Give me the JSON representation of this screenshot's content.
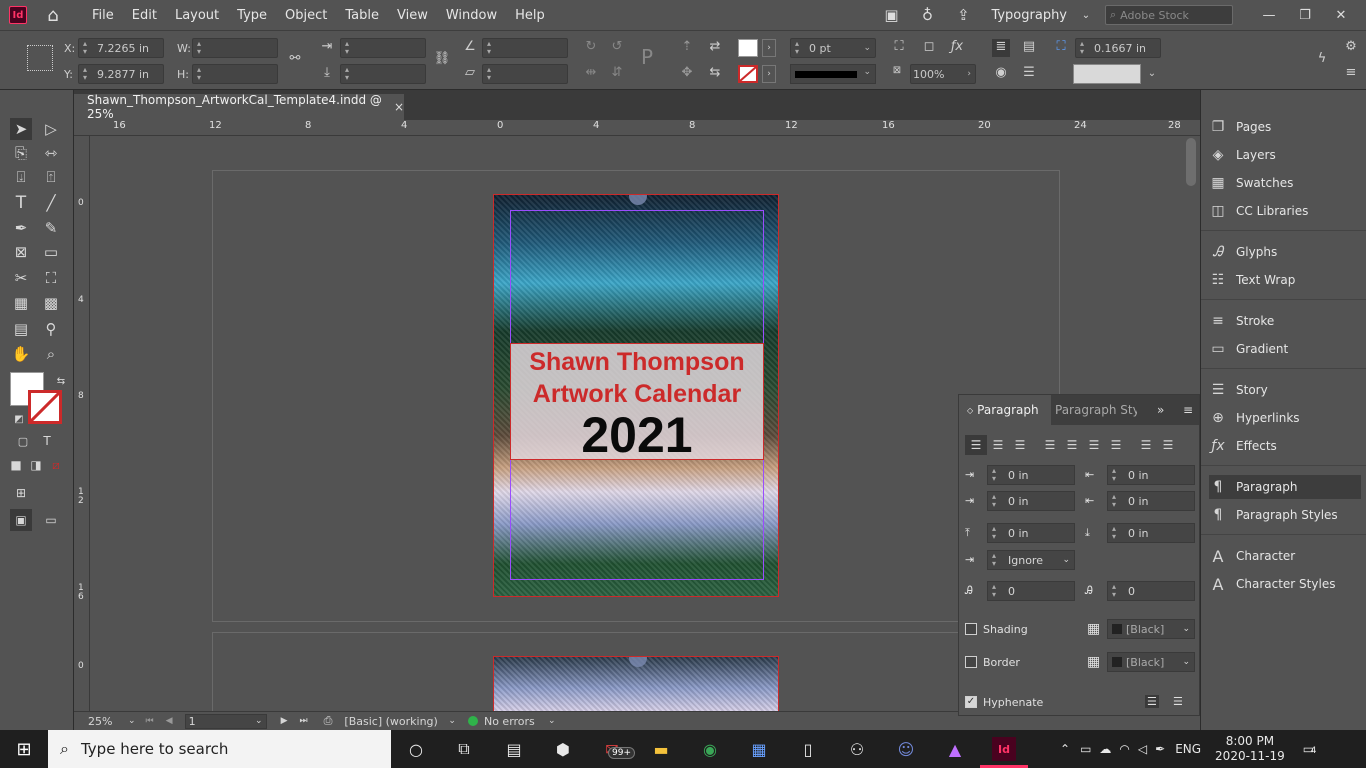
{
  "menubar": {
    "app_icon": "Id",
    "items": [
      "File",
      "Edit",
      "Layout",
      "Type",
      "Object",
      "Table",
      "View",
      "Window",
      "Help"
    ],
    "workspace": "Typography",
    "stock_placeholder": "Adobe Stock"
  },
  "control": {
    "x_label": "X:",
    "x_value": "7.2265 in",
    "y_label": "Y:",
    "y_value": "9.2877 in",
    "w_label": "W:",
    "h_label": "H:",
    "stroke_weight": "0 pt",
    "opacity": "100%",
    "gap_value": "0.1667 in"
  },
  "document": {
    "tab_title": "Shawn_Thompson_ArtworkCal_Template4.indd @ 25%",
    "close": "×",
    "title_line1": "Shawn Thompson",
    "title_line2": "Artwork Calendar",
    "year": "2021"
  },
  "rulers": {
    "h": [
      "16",
      "12",
      "8",
      "4",
      "0",
      "4",
      "8",
      "12",
      "16",
      "20",
      "24",
      "28"
    ],
    "v": [
      "0",
      "4",
      "8",
      "1\n2",
      "1\n6",
      "0"
    ]
  },
  "status": {
    "zoom": "25%",
    "page": "1",
    "style": "[Basic] (working)",
    "preflight": "No errors"
  },
  "dock": {
    "items": [
      {
        "label": "Pages",
        "icon": "pages-icon"
      },
      {
        "label": "Layers",
        "icon": "layers-icon"
      },
      {
        "label": "Swatches",
        "icon": "swatches-icon"
      },
      {
        "label": "CC Libraries",
        "icon": "libraries-icon"
      },
      {
        "label": "Glyphs",
        "icon": "glyphs-icon"
      },
      {
        "label": "Text Wrap",
        "icon": "text-wrap-icon"
      },
      {
        "label": "Stroke",
        "icon": "stroke-icon"
      },
      {
        "label": "Gradient",
        "icon": "gradient-icon"
      },
      {
        "label": "Story",
        "icon": "story-icon"
      },
      {
        "label": "Hyperlinks",
        "icon": "hyperlinks-icon"
      },
      {
        "label": "Effects",
        "icon": "effects-icon"
      },
      {
        "label": "Paragraph",
        "icon": "paragraph-icon"
      },
      {
        "label": "Paragraph Styles",
        "icon": "paragraph-styles-icon"
      },
      {
        "label": "Character",
        "icon": "character-icon"
      },
      {
        "label": "Character Styles",
        "icon": "character-styles-icon"
      }
    ]
  },
  "paragraph": {
    "tab_active": "Paragraph",
    "tab_other": "Paragraph Styl",
    "left_indent": "0 in",
    "right_indent": "0 in",
    "first_indent": "0 in",
    "last_indent": "0 in",
    "space_before": "0 in",
    "space_after": "0 in",
    "align_grid": "Ignore",
    "drop_lines": "0",
    "drop_chars": "0",
    "shading_label": "Shading",
    "shading_color": "[Black]",
    "border_label": "Border",
    "border_color": "[Black]",
    "hyphenate_label": "Hyphenate"
  },
  "taskbar": {
    "search_placeholder": "Type here to search",
    "badge": "99+",
    "lang": "ENG",
    "time": "8:00 PM",
    "date": "2020-11-19",
    "notif_count": "4"
  },
  "colors": {
    "ui_bg": "#535353",
    "accent_red": "#cc2a2a",
    "indesign": "#ff3366"
  }
}
